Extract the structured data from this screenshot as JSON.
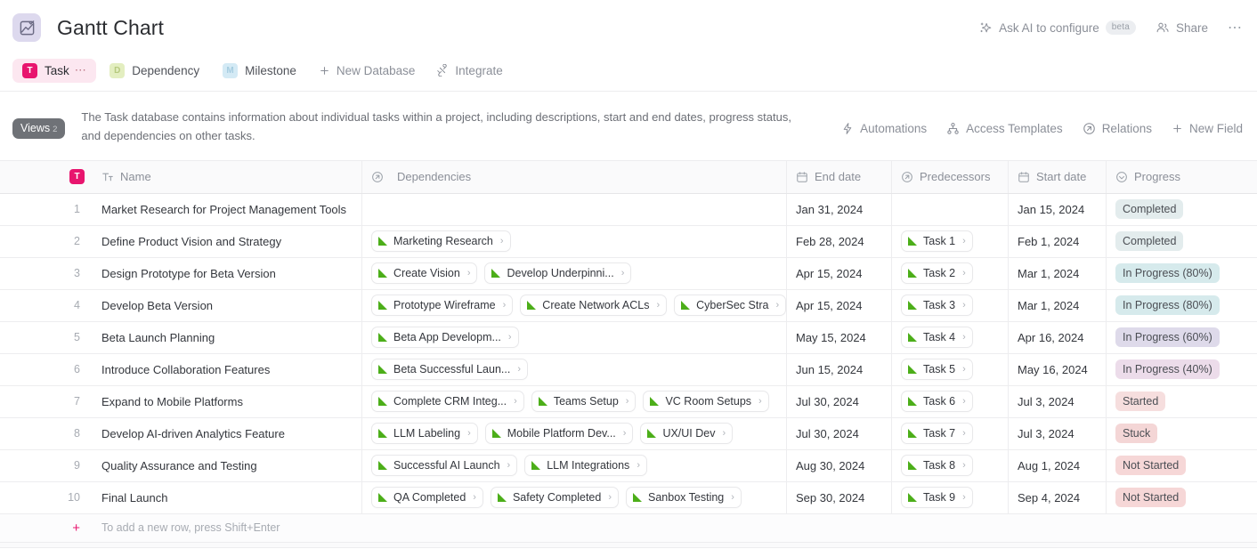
{
  "header": {
    "app_icon": "chart-check-icon",
    "title": "Gantt Chart",
    "ask_ai_label": "Ask AI to configure",
    "beta_label": "beta",
    "share_label": "Share",
    "more_label": "⋯"
  },
  "tabs": [
    {
      "label": "Task",
      "badge": "T",
      "badge_bg": "#e8156e",
      "badge_color": "#ffffff",
      "active": true,
      "has_dots": true
    },
    {
      "label": "Dependency",
      "badge": "D",
      "badge_bg": "#e3eec0",
      "badge_color": "#b6c97e",
      "active": false,
      "has_dots": false
    },
    {
      "label": "Milestone",
      "badge": "M",
      "badge_bg": "#d4eaf5",
      "badge_color": "#a6cde0",
      "active": false,
      "has_dots": false
    }
  ],
  "tab_actions": [
    {
      "label": "New Database",
      "icon": "plus-icon"
    },
    {
      "label": "Integrate",
      "icon": "integrate-icon"
    }
  ],
  "description": {
    "views_label": "Views",
    "views_count": "2",
    "text": "The Task database contains information about individual tasks within a project, including descriptions, start and end dates, progress status, and dependencies on other tasks."
  },
  "field_actions": [
    {
      "label": "Automations",
      "icon": "bolt-icon"
    },
    {
      "label": "Access Templates",
      "icon": "hierarchy-icon"
    },
    {
      "label": "Relations",
      "icon": "relation-icon"
    },
    {
      "label": "New Field",
      "icon": "plus-icon"
    }
  ],
  "table": {
    "columns": [
      {
        "key": "num",
        "label": "",
        "icon": ""
      },
      {
        "key": "name",
        "label": "Name",
        "icon": "text-icon",
        "badge": "T"
      },
      {
        "key": "deps",
        "label": "Dependencies",
        "icon": "relation-icon"
      },
      {
        "key": "end",
        "label": "End date",
        "icon": "calendar-icon"
      },
      {
        "key": "pred",
        "label": "Predecessors",
        "icon": "relation-icon"
      },
      {
        "key": "start",
        "label": "Start date",
        "icon": "calendar-icon"
      },
      {
        "key": "prog",
        "label": "Progress",
        "icon": "status-icon"
      }
    ],
    "rows": [
      {
        "num": "1",
        "name": "Market Research for Project Management Tools",
        "dependencies": [],
        "end_date": "Jan 31, 2024",
        "predecessors": [],
        "start_date": "Jan 15, 2024",
        "progress": "Completed",
        "progress_bg": "#e3eced",
        "progress_color": "#4b4e54"
      },
      {
        "num": "2",
        "name": "Define Product Vision and Strategy",
        "dependencies": [
          "Marketing Research"
        ],
        "end_date": "Feb 28, 2024",
        "predecessors": [
          "Task 1"
        ],
        "start_date": "Feb 1, 2024",
        "progress": "Completed",
        "progress_bg": "#e3eced",
        "progress_color": "#4b4e54"
      },
      {
        "num": "3",
        "name": "Design Prototype for Beta Version",
        "dependencies": [
          "Create Vision",
          "Develop Underpinni..."
        ],
        "end_date": "Apr 15, 2024",
        "predecessors": [
          "Task 2"
        ],
        "start_date": "Mar 1, 2024",
        "progress": "In Progress (80%)",
        "progress_bg": "#d6eaec",
        "progress_color": "#4b4e54"
      },
      {
        "num": "4",
        "name": "Develop Beta Version",
        "dependencies": [
          "Prototype Wireframe",
          "Create Network ACLs",
          "CyberSec Stra"
        ],
        "end_date": "Apr 15, 2024",
        "predecessors": [
          "Task 3"
        ],
        "start_date": "Mar 1, 2024",
        "progress": "In Progress (80%)",
        "progress_bg": "#d6eaec",
        "progress_color": "#4b4e54"
      },
      {
        "num": "5",
        "name": "Beta Launch Planning",
        "dependencies": [
          "Beta App Developm..."
        ],
        "end_date": "May 15, 2024",
        "predecessors": [
          "Task 4"
        ],
        "start_date": "Apr 16, 2024",
        "progress": "In Progress (60%)",
        "progress_bg": "#dedaea",
        "progress_color": "#4b4e54"
      },
      {
        "num": "6",
        "name": "Introduce Collaboration Features",
        "dependencies": [
          "Beta Successful Laun..."
        ],
        "end_date": "Jun 15, 2024",
        "predecessors": [
          "Task 5"
        ],
        "start_date": "May 16, 2024",
        "progress": "In Progress (40%)",
        "progress_bg": "#ecdcea",
        "progress_color": "#4b4e54"
      },
      {
        "num": "7",
        "name": "Expand to Mobile Platforms",
        "dependencies": [
          "Complete CRM Integ...",
          "Teams Setup",
          "VC Room Setups"
        ],
        "end_date": "Jul 30, 2024",
        "predecessors": [
          "Task 6"
        ],
        "start_date": "Jul 3, 2024",
        "progress": "Started",
        "progress_bg": "#f6dede",
        "progress_color": "#4b4e54"
      },
      {
        "num": "8",
        "name": "Develop AI-driven Analytics Feature",
        "dependencies": [
          "LLM Labeling",
          "Mobile Platform Dev...",
          "UX/UI Dev"
        ],
        "end_date": "Jul 30, 2024",
        "predecessors": [
          "Task 7"
        ],
        "start_date": "Jul 3, 2024",
        "progress": "Stuck",
        "progress_bg": "#f4d6d6",
        "progress_color": "#4b4e54"
      },
      {
        "num": "9",
        "name": "Quality Assurance and Testing",
        "dependencies": [
          "Successful AI Launch",
          "LLM Integrations"
        ],
        "end_date": "Aug 30, 2024",
        "predecessors": [
          "Task 8"
        ],
        "start_date": "Aug 1, 2024",
        "progress": "Not Started",
        "progress_bg": "#f6d7d7",
        "progress_color": "#4b4e54"
      },
      {
        "num": "10",
        "name": "Final Launch",
        "dependencies": [
          "QA Completed",
          "Safety Completed",
          "Sanbox Testing"
        ],
        "end_date": "Sep 30, 2024",
        "predecessors": [
          "Task 9"
        ],
        "start_date": "Sep 4, 2024",
        "progress": "Not Started",
        "progress_bg": "#f6d7d7",
        "progress_color": "#4b4e54"
      }
    ],
    "add_row": {
      "plus": "+",
      "hint": "To add a new row, press Shift+Enter"
    }
  }
}
